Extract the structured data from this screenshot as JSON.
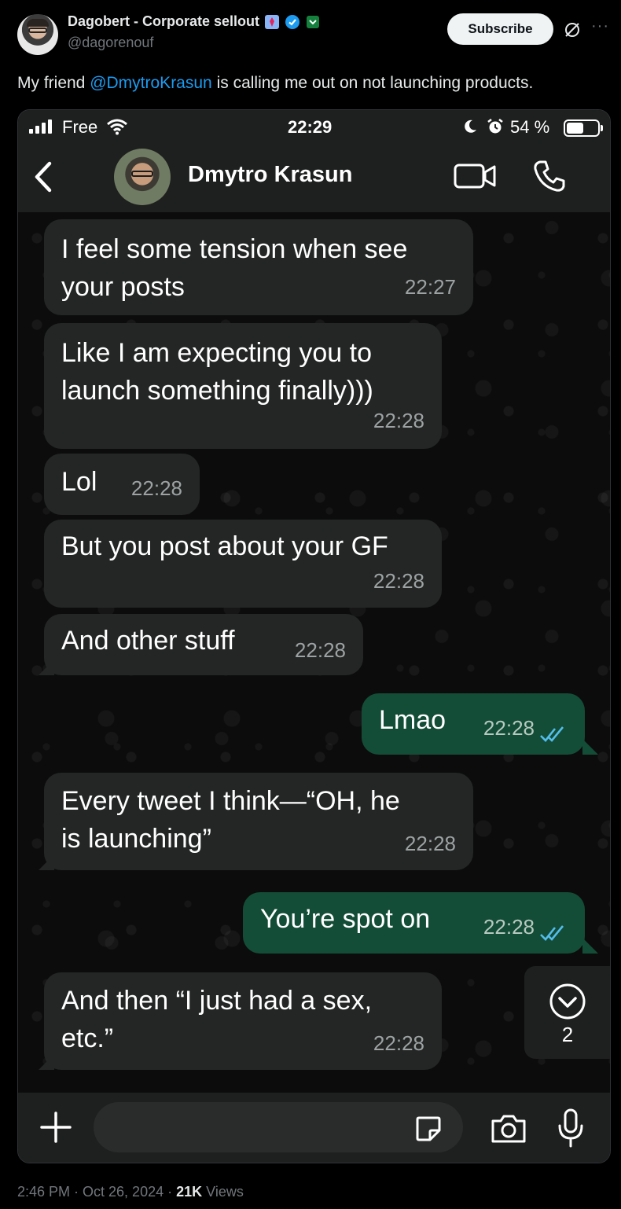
{
  "tweet": {
    "author_name": "Dagobert - Corporate sellout",
    "handle": "@dagorenouf",
    "subscribe_label": "Subscribe",
    "text_before": "My friend ",
    "mention": "@DmytroKrasun",
    "text_after": " is calling me out on not launching products.",
    "footer_time": "2:46 PM · Oct 26, 2024 · ",
    "views_count": "21K",
    "views_label": " Views"
  },
  "phone": {
    "status": {
      "carrier": "Free",
      "time": "22:29",
      "battery": "54 %",
      "battery_level": 0.54
    },
    "chat": {
      "contact_name": "Dmytro Krasun",
      "messages": [
        {
          "dir": "in",
          "text": "I feel some tension when see\nyour posts",
          "time": "22:27"
        },
        {
          "dir": "in",
          "text": "Like I am expecting you to\nlaunch something finally)))",
          "time": "22:28"
        },
        {
          "dir": "in",
          "text": "Lol",
          "time": "22:28"
        },
        {
          "dir": "in",
          "text": "But you post about your GF",
          "time": "22:28"
        },
        {
          "dir": "in",
          "text": "And other stuff",
          "time": "22:28"
        },
        {
          "dir": "out",
          "text": "Lmao",
          "time": "22:28",
          "status": "read"
        },
        {
          "dir": "in",
          "text": "Every tweet I think—“OH, he\nis launching”",
          "time": "22:28"
        },
        {
          "dir": "out",
          "text": "You’re spot on",
          "time": "22:28",
          "status": "read"
        },
        {
          "dir": "in",
          "text": "And then “I just had a sex,\netc.”",
          "time": "22:28"
        }
      ],
      "unread_count": "2"
    },
    "colors": {
      "incoming_bubble": "#242626",
      "outgoing_bubble": "#144d37",
      "read_ticks": "#53bdeb"
    }
  }
}
